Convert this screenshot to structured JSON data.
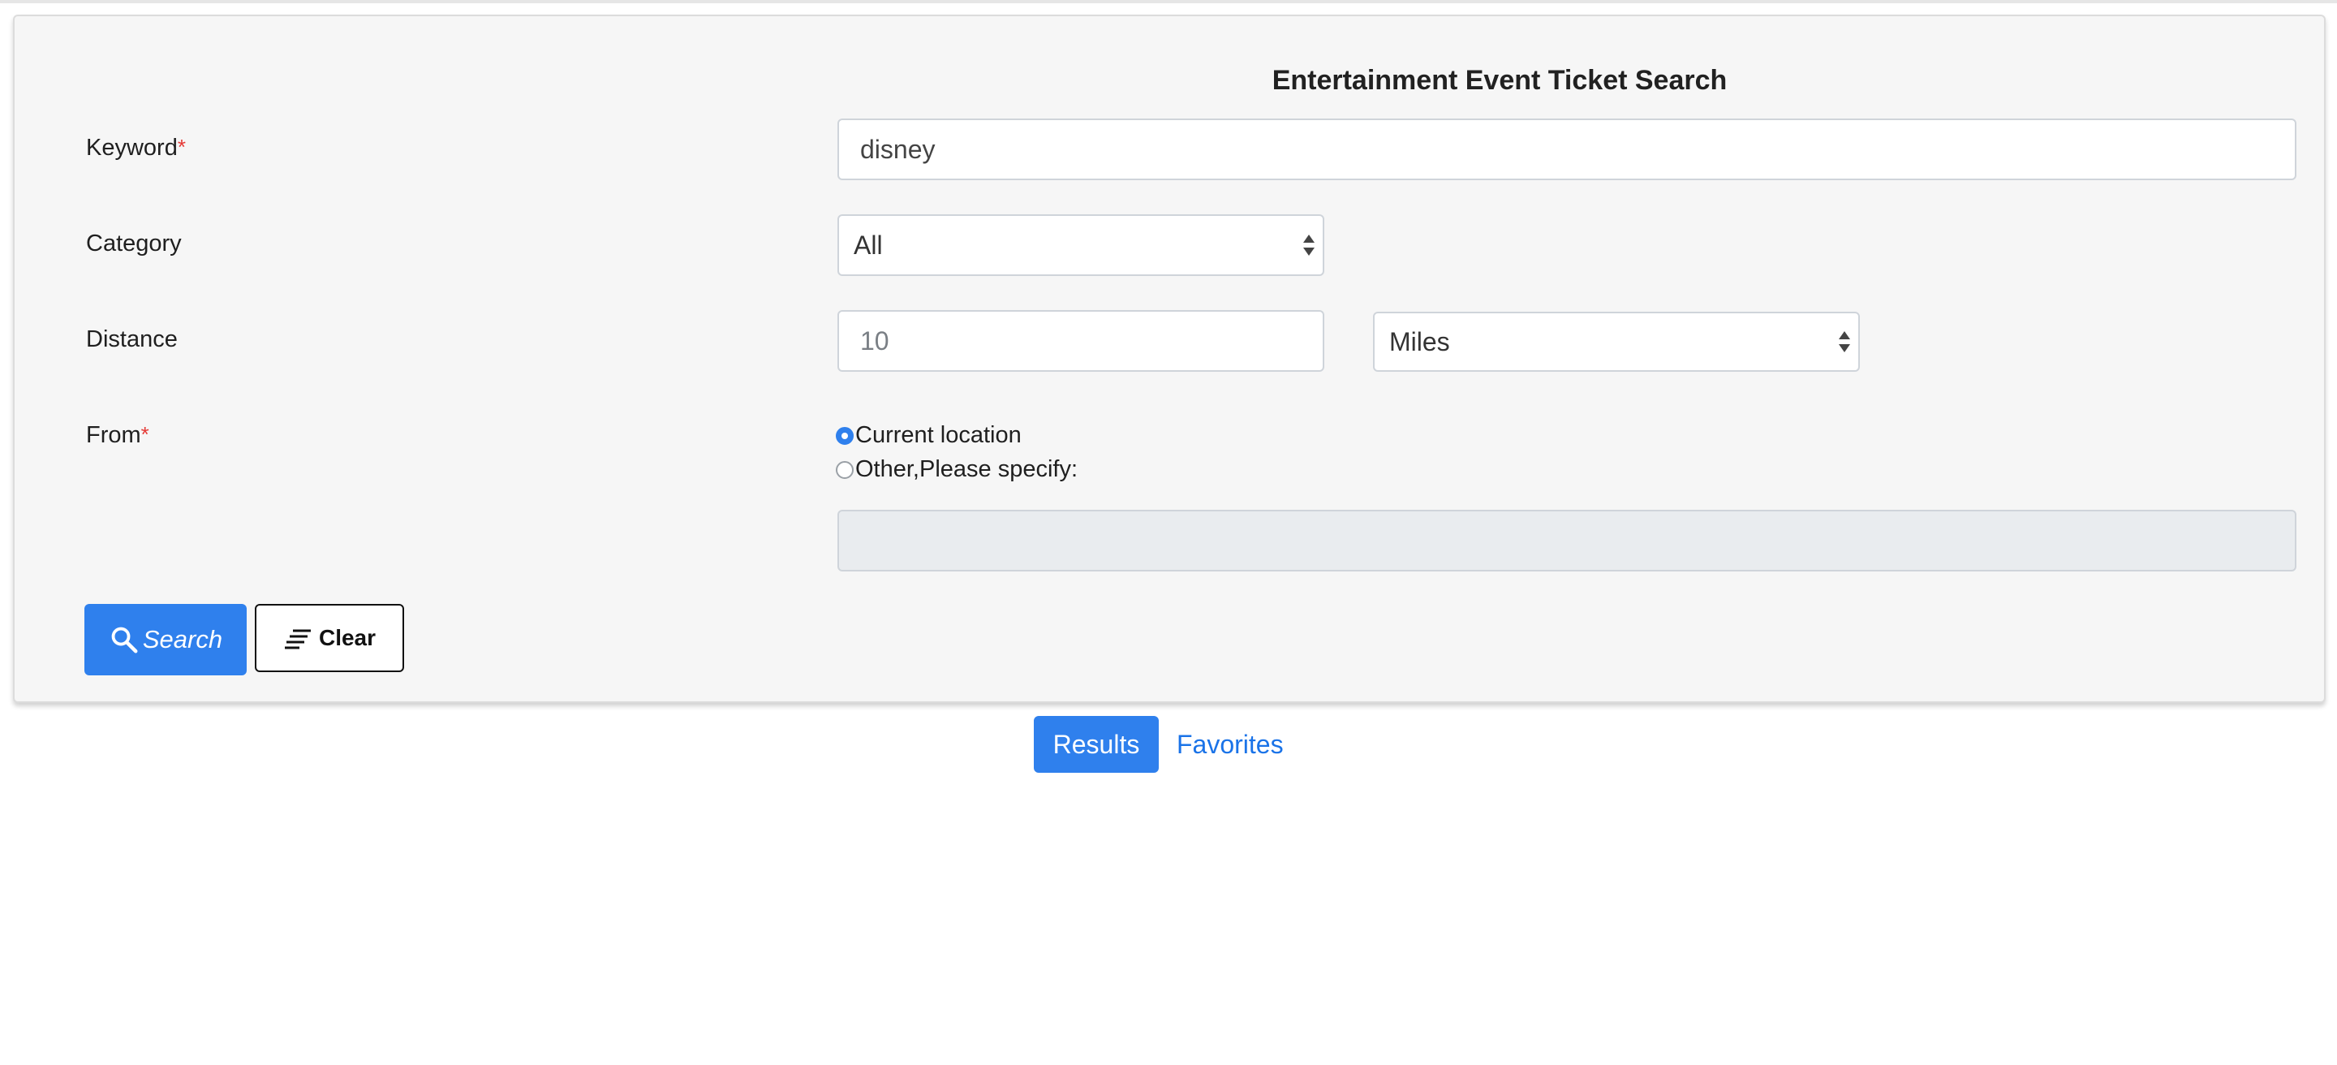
{
  "form": {
    "title": "Entertainment Event Ticket Search",
    "keyword": {
      "label": "Keyword",
      "required_mark": "*",
      "value": "disney"
    },
    "category": {
      "label": "Category",
      "selected": "All"
    },
    "distance": {
      "label": "Distance",
      "placeholder": "10",
      "unit_selected": "Miles"
    },
    "from": {
      "label": "From",
      "required_mark": "*",
      "options": [
        {
          "label": "Current location",
          "checked": true
        },
        {
          "label": "Other,Please specify:",
          "checked": false
        }
      ],
      "other_value": ""
    },
    "buttons": {
      "search_label": "Search",
      "clear_label": "Clear"
    }
  },
  "tabs": {
    "results_label": "Results",
    "favorites_label": "Favorites"
  },
  "colors": {
    "accent": "#2f80ed",
    "required": "#e53935",
    "link": "#1a73e8"
  },
  "icons": {
    "search": "search-icon",
    "clear": "clear-lines-icon"
  }
}
